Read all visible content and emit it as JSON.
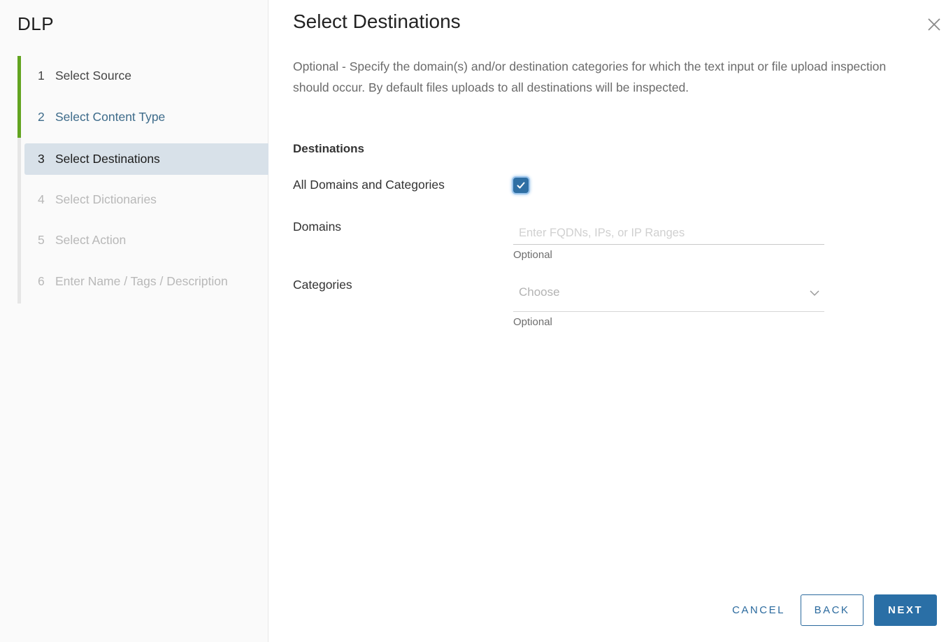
{
  "sidebar": {
    "app_title": "DLP",
    "steps": [
      {
        "number": "1",
        "label": "Select Source",
        "state": "done"
      },
      {
        "number": "2",
        "label": "Select Content Type",
        "state": "visited"
      },
      {
        "number": "3",
        "label": "Select Destinations",
        "state": "active"
      },
      {
        "number": "4",
        "label": "Select Dictionaries",
        "state": "pending"
      },
      {
        "number": "5",
        "label": "Select Action",
        "state": "pending"
      },
      {
        "number": "6",
        "label": "Enter Name / Tags / Description",
        "state": "pending"
      }
    ],
    "progress_completed_steps": 2,
    "progress_color": "#62a420"
  },
  "main": {
    "title": "Select Destinations",
    "description": "Optional - Specify the domain(s) and/or destination categories for which the text input or file upload inspection should occur. By default files uploads to all destinations will be inspected.",
    "section_title": "Destinations",
    "all_domains": {
      "label": "All Domains and Categories",
      "checked": true
    },
    "domains": {
      "label": "Domains",
      "value": "",
      "placeholder": "Enter FQDNs, IPs, or IP Ranges",
      "helper": "Optional"
    },
    "categories": {
      "label": "Categories",
      "selected": "Choose",
      "helper": "Optional"
    }
  },
  "footer": {
    "cancel_label": "CANCEL",
    "back_label": "BACK",
    "next_label": "NEXT"
  },
  "colors": {
    "accent": "#2a6fa6",
    "active_step_bg": "#d8e1e9"
  }
}
